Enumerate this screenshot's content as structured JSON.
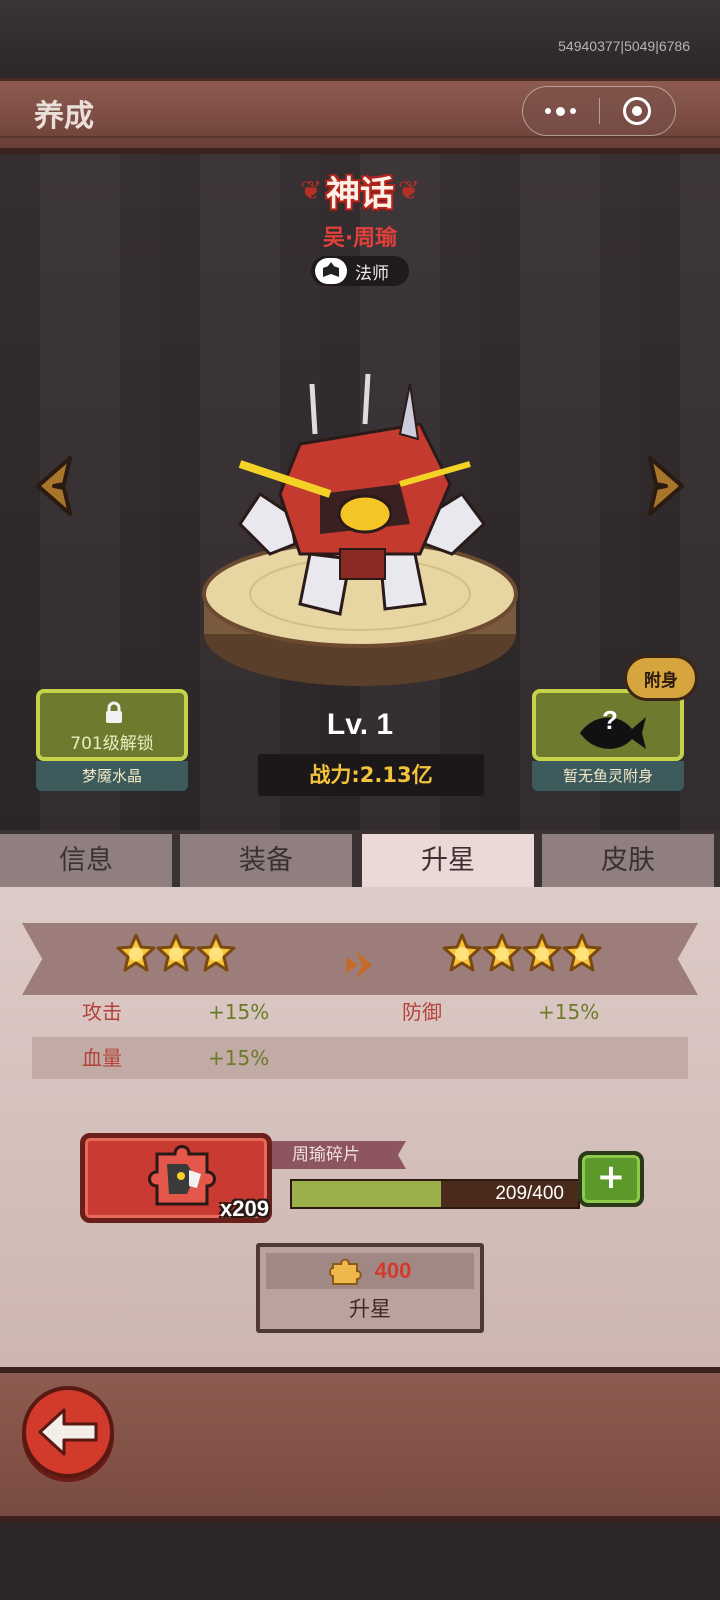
{
  "status": {
    "debug_id": "54940377|5049|6786"
  },
  "header": {
    "title": "养成",
    "capsule": {
      "menu_icon": "more-dots-icon",
      "close_icon": "target-close-icon"
    }
  },
  "hero": {
    "rarity": "神话",
    "name": "吴·周瑜",
    "class_label": "法师",
    "level": "Lv. 1",
    "power": "战力:2.13亿"
  },
  "left_card": {
    "lock_text": "701级解锁",
    "caption": "梦魇水晶"
  },
  "right_card": {
    "badge": "附身",
    "caption": "暂无鱼灵附身"
  },
  "tabs": [
    {
      "label": "信息"
    },
    {
      "label": "装备"
    },
    {
      "label": "升星"
    },
    {
      "label": "皮肤"
    }
  ],
  "active_tab": "升星",
  "star_upgrade": {
    "current_stars": 3,
    "next_stars": 4
  },
  "stats": {
    "attack_label": "攻击",
    "attack_value": "+15%",
    "defense_label": "防御",
    "defense_value": "+15%",
    "hp_label": "血量",
    "hp_value": "+15%"
  },
  "fragment": {
    "name": "周瑜碎片",
    "count": "x209",
    "progress_text": "209/400",
    "progress_current": 209,
    "progress_max": 400
  },
  "upgrade": {
    "cost": "400",
    "label": "升星"
  },
  "colors": {
    "accent_red": "#c83a32",
    "power_gold": "#f3c33b",
    "progress_green": "#9bb04a"
  }
}
